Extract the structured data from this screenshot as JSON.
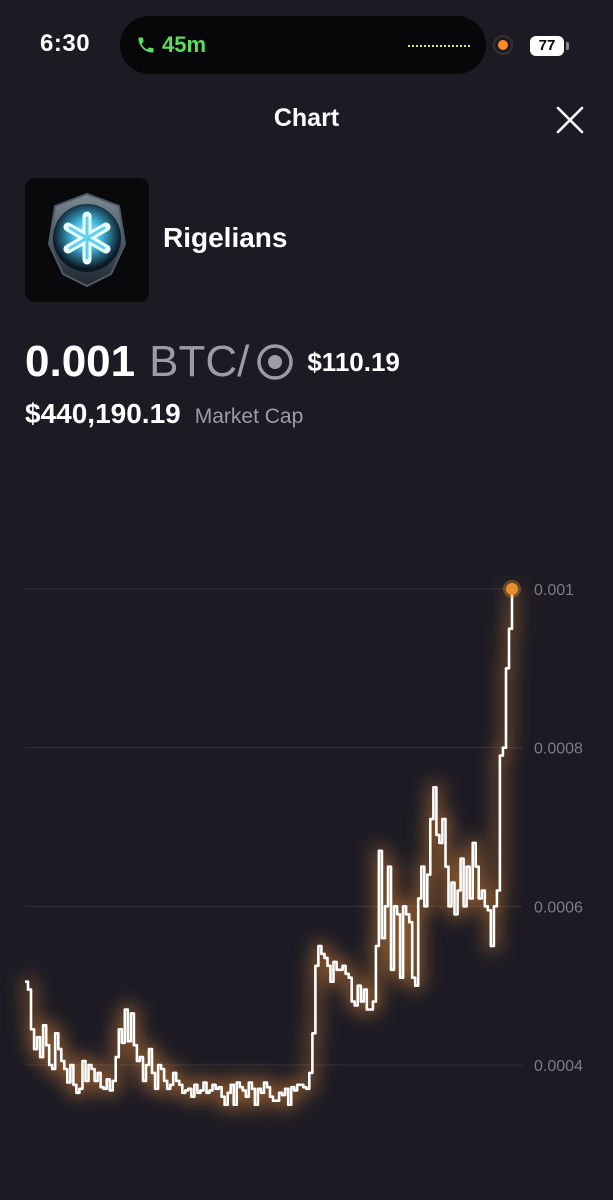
{
  "status_bar": {
    "time": "6:30",
    "call_duration": "45m",
    "battery": "77",
    "accent_call": "#5ddc5e",
    "accent_recording": "#ff8a2a"
  },
  "header": {
    "title": "Chart",
    "close_icon": "close-icon"
  },
  "token": {
    "name": "Rigelians",
    "avatar_icon": "asterisk-shield-icon"
  },
  "price": {
    "value": "0.001",
    "unit": "BTC",
    "separator": "/",
    "unit_icon": "target-icon",
    "usd": "$110.19"
  },
  "market_cap": {
    "value": "$440,190.19",
    "label": "Market Cap"
  },
  "chart_data": {
    "type": "line",
    "y_ticks": [
      "0.001",
      "0.0008",
      "0.0006",
      "0.0004"
    ],
    "ylim": [
      0.00035,
      0.001
    ],
    "grid": true,
    "line_color": "#ffffff",
    "glow_color": "#ff9a3c",
    "marker_color": "#e6902e",
    "values": [
      0.000505,
      0.000495,
      0.000445,
      0.00042,
      0.000435,
      0.00041,
      0.00045,
      0.000425,
      0.0004,
      0.000395,
      0.00044,
      0.00042,
      0.000405,
      0.000395,
      0.000378,
      0.0004,
      0.000375,
      0.000365,
      0.00037,
      0.000405,
      0.00038,
      0.0004,
      0.000395,
      0.00038,
      0.00039,
      0.000372,
      0.00037,
      0.000382,
      0.000368,
      0.00038,
      0.00041,
      0.000445,
      0.000428,
      0.00047,
      0.00043,
      0.000465,
      0.000425,
      0.000405,
      0.00041,
      0.00038,
      0.0004,
      0.00042,
      0.00039,
      0.00037,
      0.0004,
      0.000395,
      0.00038,
      0.00037,
      0.000375,
      0.00039,
      0.00038,
      0.000375,
      0.000365,
      0.000368,
      0.00037,
      0.00036,
      0.000375,
      0.000365,
      0.000368,
      0.000378,
      0.000365,
      0.000368,
      0.000375,
      0.00037,
      0.000372,
      0.00036,
      0.00035,
      0.000365,
      0.000375,
      0.00035,
      0.000378,
      0.000372,
      0.000368,
      0.00036,
      0.000378,
      0.00037,
      0.00035,
      0.00037,
      0.000365,
      0.000378,
      0.000372,
      0.00036,
      0.000355,
      0.000355,
      0.000365,
      0.000362,
      0.00037,
      0.00035,
      0.000372,
      0.000368,
      0.000375,
      0.000375,
      0.000372,
      0.00037,
      0.00039,
      0.00044,
      0.000525,
      0.00055,
      0.00054,
      0.000535,
      0.000525,
      0.000505,
      0.00053,
      0.00052,
      0.00052,
      0.000525,
      0.000515,
      0.00051,
      0.00048,
      0.000475,
      0.0005,
      0.00048,
      0.000495,
      0.00047,
      0.00047,
      0.00048,
      0.00055,
      0.00067,
      0.00056,
      0.0006,
      0.00065,
      0.00052,
      0.0006,
      0.00059,
      0.00051,
      0.0006,
      0.00059,
      0.00058,
      0.00051,
      0.0005,
      0.00061,
      0.00065,
      0.0006,
      0.00064,
      0.00071,
      0.00075,
      0.00069,
      0.00068,
      0.00071,
      0.00065,
      0.0006,
      0.00063,
      0.00059,
      0.00062,
      0.00066,
      0.0006,
      0.00065,
      0.00061,
      0.00068,
      0.00065,
      0.00061,
      0.00062,
      0.0006,
      0.000595,
      0.00055,
      0.0006,
      0.00062,
      0.00079,
      0.0008,
      0.0009,
      0.00095,
      0.001
    ]
  }
}
